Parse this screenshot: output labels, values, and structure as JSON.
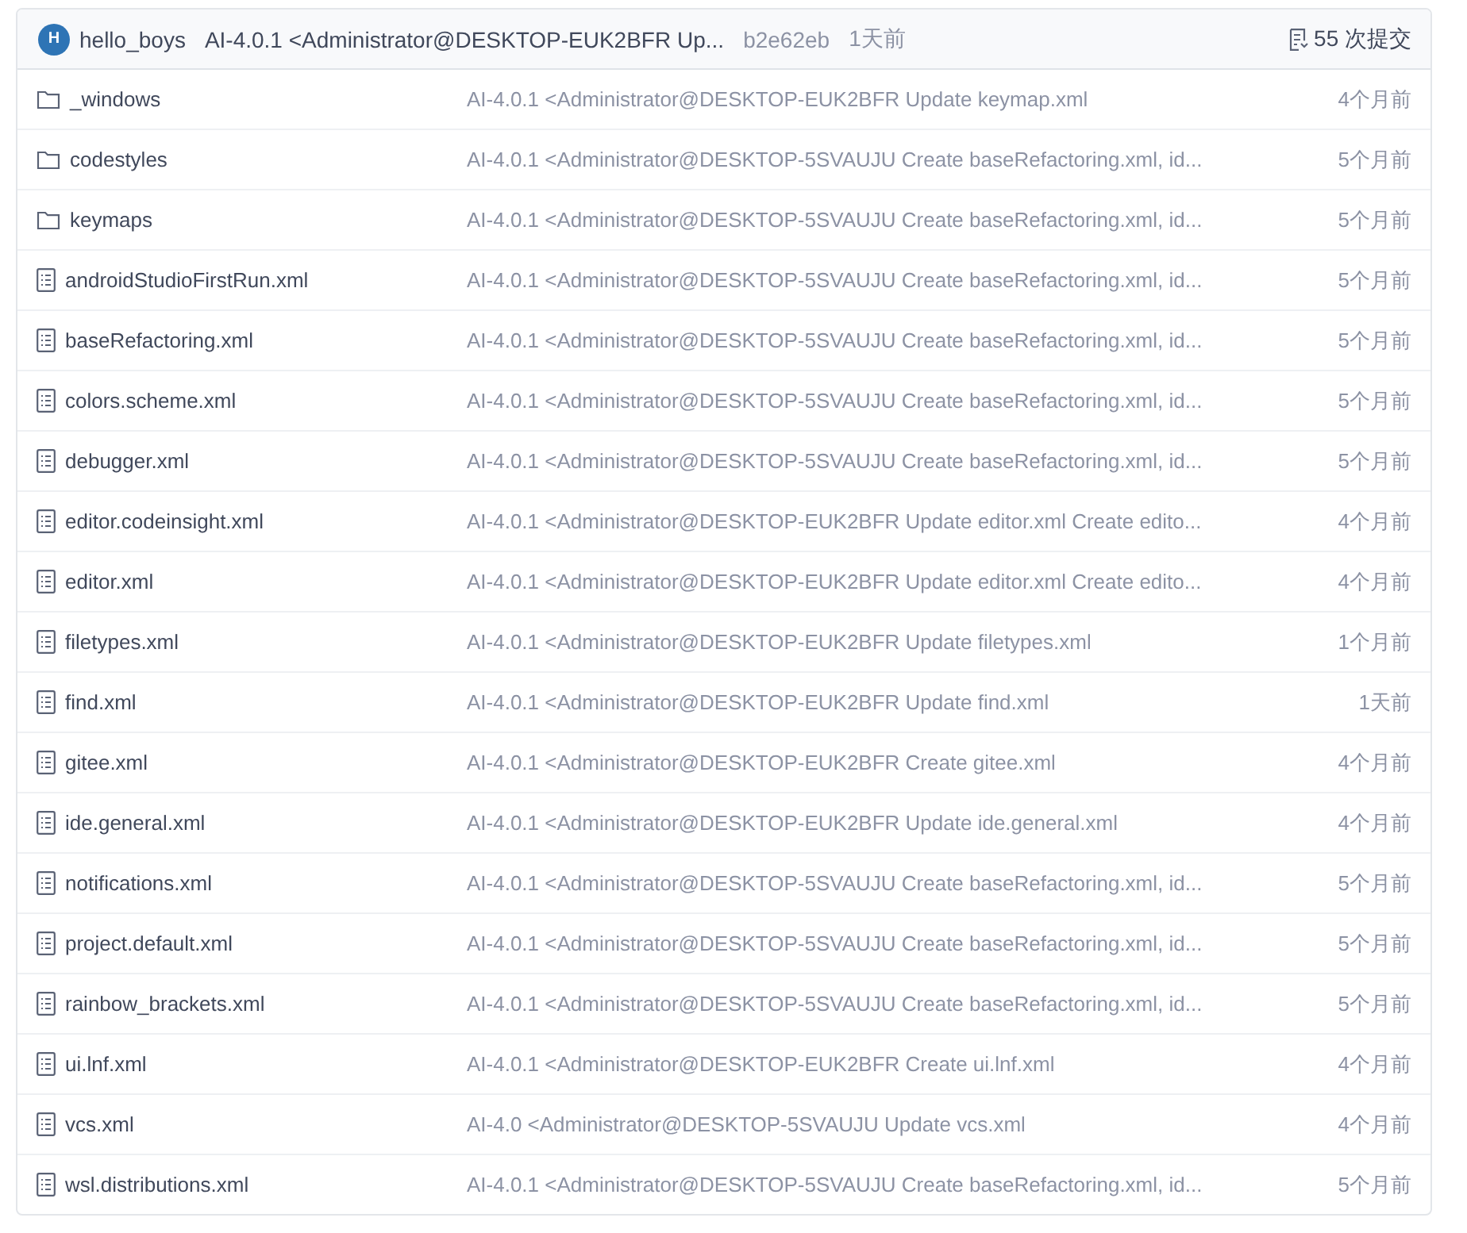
{
  "latest_commit": {
    "avatar_letter": "H",
    "author": "hello_boys",
    "message": "AI-4.0.1 <Administrator@DESKTOP-EUK2BFR Up...",
    "hash": "b2e62eb",
    "time": "1天前",
    "commit_count": "55 次提交"
  },
  "files": [
    {
      "kind": "folder",
      "name": "_windows",
      "message": "AI-4.0.1 <Administrator@DESKTOP-EUK2BFR Update keymap.xml",
      "time": "4个月前"
    },
    {
      "kind": "folder",
      "name": "codestyles",
      "message": "AI-4.0.1 <Administrator@DESKTOP-5SVAUJU Create baseRefactoring.xml, id...",
      "time": "5个月前"
    },
    {
      "kind": "folder",
      "name": "keymaps",
      "message": "AI-4.0.1 <Administrator@DESKTOP-5SVAUJU Create baseRefactoring.xml, id...",
      "time": "5个月前"
    },
    {
      "kind": "file",
      "name": "androidStudioFirstRun.xml",
      "message": "AI-4.0.1 <Administrator@DESKTOP-5SVAUJU Create baseRefactoring.xml, id...",
      "time": "5个月前"
    },
    {
      "kind": "file",
      "name": "baseRefactoring.xml",
      "message": "AI-4.0.1 <Administrator@DESKTOP-5SVAUJU Create baseRefactoring.xml, id...",
      "time": "5个月前"
    },
    {
      "kind": "file",
      "name": "colors.scheme.xml",
      "message": "AI-4.0.1 <Administrator@DESKTOP-5SVAUJU Create baseRefactoring.xml, id...",
      "time": "5个月前"
    },
    {
      "kind": "file",
      "name": "debugger.xml",
      "message": "AI-4.0.1 <Administrator@DESKTOP-5SVAUJU Create baseRefactoring.xml, id...",
      "time": "5个月前"
    },
    {
      "kind": "file",
      "name": "editor.codeinsight.xml",
      "message": "AI-4.0.1 <Administrator@DESKTOP-EUK2BFR Update editor.xml Create edito...",
      "time": "4个月前"
    },
    {
      "kind": "file",
      "name": "editor.xml",
      "message": "AI-4.0.1 <Administrator@DESKTOP-EUK2BFR Update editor.xml Create edito...",
      "time": "4个月前"
    },
    {
      "kind": "file",
      "name": "filetypes.xml",
      "message": "AI-4.0.1 <Administrator@DESKTOP-EUK2BFR Update filetypes.xml",
      "time": "1个月前"
    },
    {
      "kind": "file",
      "name": "find.xml",
      "message": "AI-4.0.1 <Administrator@DESKTOP-EUK2BFR Update find.xml",
      "time": "1天前"
    },
    {
      "kind": "file",
      "name": "gitee.xml",
      "message": "AI-4.0.1 <Administrator@DESKTOP-EUK2BFR Create gitee.xml",
      "time": "4个月前"
    },
    {
      "kind": "file",
      "name": "ide.general.xml",
      "message": "AI-4.0.1 <Administrator@DESKTOP-EUK2BFR Update ide.general.xml",
      "time": "4个月前"
    },
    {
      "kind": "file",
      "name": "notifications.xml",
      "message": "AI-4.0.1 <Administrator@DESKTOP-5SVAUJU Create baseRefactoring.xml, id...",
      "time": "5个月前"
    },
    {
      "kind": "file",
      "name": "project.default.xml",
      "message": "AI-4.0.1 <Administrator@DESKTOP-5SVAUJU Create baseRefactoring.xml, id...",
      "time": "5个月前"
    },
    {
      "kind": "file",
      "name": "rainbow_brackets.xml",
      "message": "AI-4.0.1 <Administrator@DESKTOP-5SVAUJU Create baseRefactoring.xml, id...",
      "time": "5个月前"
    },
    {
      "kind": "file",
      "name": "ui.lnf.xml",
      "message": "AI-4.0.1 <Administrator@DESKTOP-EUK2BFR Create ui.lnf.xml",
      "time": "4个月前"
    },
    {
      "kind": "file",
      "name": "vcs.xml",
      "message": "AI-4.0 <Administrator@DESKTOP-5SVAUJU Update vcs.xml",
      "time": "4个月前"
    },
    {
      "kind": "file",
      "name": "wsl.distributions.xml",
      "message": "AI-4.0.1 <Administrator@DESKTOP-5SVAUJU Create baseRefactoring.xml, id...",
      "time": "5个月前"
    }
  ]
}
